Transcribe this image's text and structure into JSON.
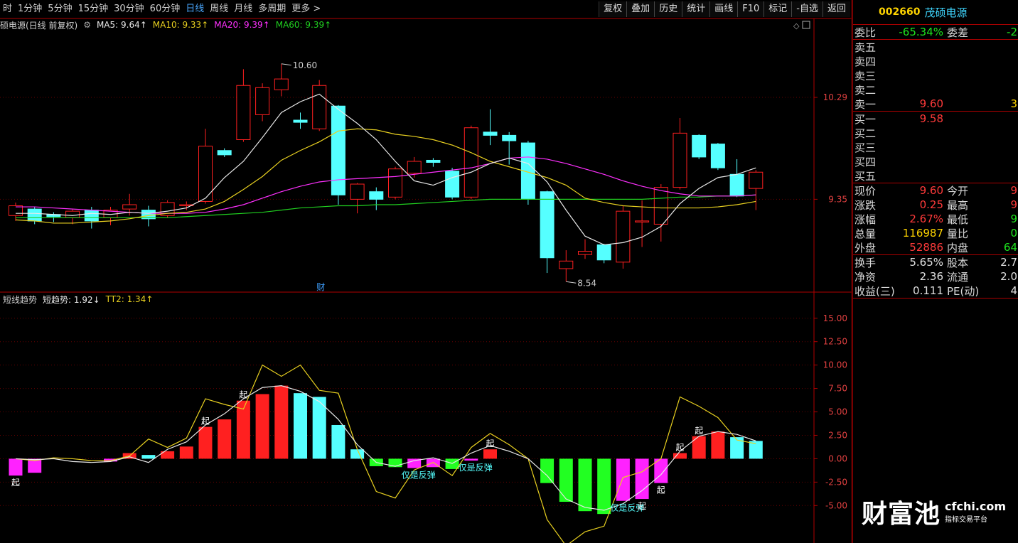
{
  "toolbar": {
    "periods": [
      "时",
      "1分钟",
      "5分钟",
      "15分钟",
      "30分钟",
      "60分钟",
      "日线",
      "周线",
      "月线",
      "多周期",
      "更多 >"
    ],
    "active_index": 6,
    "buttons": [
      "复权",
      "叠加",
      "历史",
      "统计",
      "画线",
      "F10",
      "标记",
      "-自选",
      "返回"
    ]
  },
  "legend": {
    "title": "硕电源(日线 前复权)",
    "ma5": "MA5: 9.64↑",
    "ma10": "MA10: 9.33↑",
    "ma20": "MA20: 9.39↑",
    "ma60": "MA60: 9.39↑"
  },
  "indicator_legend": {
    "name": "短线趋势",
    "short": "短趋势: 1.92↓",
    "tt2": "TT2: 1.34↑"
  },
  "colors": {
    "up": "#ff2020",
    "down": "#55ffff",
    "ma5": "#e8e8e8",
    "ma10": "#e8d020",
    "ma20": "#ff30ff",
    "ma60": "#20d020",
    "tt2": "#e8d020",
    "hist_green": "#22ff22",
    "hist_magenta": "#ff22ff",
    "axis": "#b00000"
  },
  "chart_data": [
    {
      "type": "candlestick",
      "name": "daily-kline",
      "price_axis": {
        "min": 8.5,
        "max": 10.9,
        "ticks": [
          10.29,
          9.35
        ]
      },
      "high_label": "10.60",
      "low_label": "8.54",
      "marker": "财",
      "candles": [
        {
          "o": 9.2,
          "c": 9.29,
          "h": 9.32,
          "l": 9.15
        },
        {
          "o": 9.26,
          "c": 9.15,
          "h": 9.28,
          "l": 9.12
        },
        {
          "o": 9.21,
          "c": 9.19,
          "h": 9.23,
          "l": 9.14
        },
        {
          "o": 9.18,
          "c": 9.24,
          "h": 9.26,
          "l": 9.12
        },
        {
          "o": 9.25,
          "c": 9.15,
          "h": 9.28,
          "l": 9.08
        },
        {
          "o": 9.18,
          "c": 9.25,
          "h": 9.28,
          "l": 9.11
        },
        {
          "o": 9.26,
          "c": 9.3,
          "h": 9.4,
          "l": 9.2
        },
        {
          "o": 9.25,
          "c": 9.17,
          "h": 9.29,
          "l": 9.1
        },
        {
          "o": 9.2,
          "c": 9.32,
          "h": 9.34,
          "l": 9.18
        },
        {
          "o": 9.3,
          "c": 9.3,
          "h": 9.33,
          "l": 9.25
        },
        {
          "o": 9.33,
          "c": 9.84,
          "h": 10.0,
          "l": 9.31
        },
        {
          "o": 9.8,
          "c": 9.76,
          "h": 9.82,
          "l": 9.74
        },
        {
          "o": 9.9,
          "c": 10.4,
          "h": 10.55,
          "l": 9.88
        },
        {
          "o": 10.13,
          "c": 10.38,
          "h": 10.42,
          "l": 10.07
        },
        {
          "o": 10.36,
          "c": 10.46,
          "h": 10.6,
          "l": 10.3
        },
        {
          "o": 10.08,
          "c": 10.06,
          "h": 10.15,
          "l": 10.0
        },
        {
          "o": 10.0,
          "c": 10.4,
          "h": 10.45,
          "l": 9.98
        },
        {
          "o": 10.21,
          "c": 9.39,
          "h": 10.22,
          "l": 9.3
        },
        {
          "o": 9.35,
          "c": 9.49,
          "h": 9.5,
          "l": 9.22
        },
        {
          "o": 9.42,
          "c": 9.35,
          "h": 9.46,
          "l": 9.25
        },
        {
          "o": 9.37,
          "c": 9.63,
          "h": 9.65,
          "l": 9.35
        },
        {
          "o": 9.59,
          "c": 9.7,
          "h": 9.74,
          "l": 9.55
        },
        {
          "o": 9.71,
          "c": 9.69,
          "h": 9.73,
          "l": 9.65
        },
        {
          "o": 9.61,
          "c": 9.37,
          "h": 9.64,
          "l": 9.35
        },
        {
          "o": 9.37,
          "c": 10.01,
          "h": 10.03,
          "l": 9.35
        },
        {
          "o": 9.97,
          "c": 9.94,
          "h": 10.18,
          "l": 9.85
        },
        {
          "o": 9.94,
          "c": 9.89,
          "h": 9.97,
          "l": 9.67
        },
        {
          "o": 9.87,
          "c": 9.35,
          "h": 9.89,
          "l": 9.3
        },
        {
          "o": 9.42,
          "c": 8.81,
          "h": 9.43,
          "l": 8.67
        },
        {
          "o": 8.71,
          "c": 8.78,
          "h": 8.88,
          "l": 8.59
        },
        {
          "o": 8.84,
          "c": 8.87,
          "h": 8.98,
          "l": 8.8
        },
        {
          "o": 8.93,
          "c": 8.79,
          "h": 8.94,
          "l": 8.76
        },
        {
          "o": 8.77,
          "c": 9.24,
          "h": 9.29,
          "l": 8.71
        },
        {
          "o": 9.15,
          "c": 9.15,
          "h": 9.34,
          "l": 8.91
        },
        {
          "o": 9.12,
          "c": 9.46,
          "h": 9.49,
          "l": 8.96
        },
        {
          "o": 9.46,
          "c": 9.96,
          "h": 10.1,
          "l": 9.44
        },
        {
          "o": 9.94,
          "c": 9.74,
          "h": 9.95,
          "l": 9.72
        },
        {
          "o": 9.86,
          "c": 9.64,
          "h": 9.87,
          "l": 9.62
        },
        {
          "o": 9.58,
          "c": 9.38,
          "h": 9.72,
          "l": 9.37
        },
        {
          "o": 9.45,
          "c": 9.6,
          "h": 9.62,
          "l": 9.25
        }
      ],
      "ma5": [
        9.22,
        9.22,
        9.21,
        9.2,
        9.22,
        9.21,
        9.23,
        9.22,
        9.24,
        9.27,
        9.36,
        9.55,
        9.7,
        9.92,
        10.15,
        10.25,
        10.32,
        10.18,
        10.05,
        9.9,
        9.7,
        9.52,
        9.48,
        9.55,
        9.6,
        9.68,
        9.73,
        9.68,
        9.51,
        9.25,
        9.01,
        8.93,
        8.95,
        9.0,
        9.1,
        9.31,
        9.45,
        9.55,
        9.58,
        9.64
      ],
      "ma10": [
        9.16,
        9.15,
        9.13,
        9.13,
        9.14,
        9.15,
        9.17,
        9.2,
        9.22,
        9.23,
        9.26,
        9.33,
        9.44,
        9.56,
        9.71,
        9.8,
        9.88,
        9.98,
        10.0,
        9.99,
        9.95,
        9.93,
        9.9,
        9.85,
        9.78,
        9.7,
        9.65,
        9.6,
        9.55,
        9.48,
        9.36,
        9.32,
        9.29,
        9.28,
        9.27,
        9.27,
        9.27,
        9.28,
        9.3,
        9.33
      ],
      "ma20": [
        9.28,
        9.28,
        9.27,
        9.26,
        9.25,
        9.24,
        9.23,
        9.22,
        9.22,
        9.22,
        9.23,
        9.26,
        9.3,
        9.36,
        9.42,
        9.47,
        9.51,
        9.53,
        9.54,
        9.55,
        9.56,
        9.58,
        9.6,
        9.62,
        9.64,
        9.68,
        9.73,
        9.74,
        9.72,
        9.68,
        9.63,
        9.58,
        9.52,
        9.47,
        9.43,
        9.4,
        9.38,
        9.38,
        9.38,
        9.39
      ],
      "ma60": [
        9.18,
        9.18,
        9.18,
        9.18,
        9.18,
        9.18,
        9.18,
        9.18,
        9.18,
        9.19,
        9.2,
        9.21,
        9.22,
        9.23,
        9.25,
        9.27,
        9.28,
        9.29,
        9.29,
        9.3,
        9.3,
        9.31,
        9.32,
        9.33,
        9.34,
        9.35,
        9.35,
        9.35,
        9.35,
        9.35,
        9.35,
        9.35,
        9.35,
        9.35,
        9.36,
        9.37,
        9.37,
        9.38,
        9.38,
        9.39
      ]
    },
    {
      "type": "bar",
      "name": "short-trend-indicator",
      "y_axis": {
        "min": -9.0,
        "max": 16.5,
        "ticks": [
          15.0,
          12.5,
          10.0,
          7.5,
          5.0,
          2.5,
          0.0,
          -2.5,
          -5.0
        ]
      },
      "bars": [
        -1.8,
        -1.5,
        0,
        0,
        0,
        -0.3,
        0.6,
        0.4,
        0.8,
        1.3,
        3.4,
        4.2,
        6.2,
        6.9,
        7.8,
        7.0,
        6.6,
        3.6,
        1.0,
        -0.8,
        -0.9,
        -1.0,
        -0.9,
        -1.1,
        -0.2,
        1.0,
        0,
        0,
        -2.6,
        -4.6,
        -5.6,
        -5.9,
        -4.5,
        -4.3,
        -2.6,
        0.6,
        2.4,
        2.9,
        2.3,
        1.9
      ],
      "bar_colors": [
        "m",
        "m",
        "",
        "",
        "",
        "m",
        "r",
        "c",
        "r",
        "r",
        "r",
        "r",
        "r",
        "r",
        "r",
        "c",
        "c",
        "c",
        "c",
        "g",
        "g",
        "m",
        "m",
        "g",
        "m",
        "r",
        "",
        "",
        "g",
        "g",
        "g",
        "g",
        "m",
        "m",
        "m",
        "r",
        "r",
        "r",
        "c",
        "c"
      ],
      "tt2": [
        0,
        -0.2,
        0.1,
        0,
        -0.2,
        -0.2,
        0.3,
        2.1,
        1.2,
        2.2,
        6.4,
        5.8,
        5.3,
        10.0,
        8.8,
        10.0,
        7.3,
        7.0,
        1.0,
        -3.5,
        -4.2,
        -1.2,
        -0.4,
        -1.8,
        1.2,
        2.7,
        1.5,
        0,
        -6.5,
        -9.3,
        -7.8,
        -7.2,
        -2.0,
        -1.4,
        0.0,
        6.6,
        5.6,
        4.4,
        2.0,
        1.6
      ],
      "ma_line": [
        0,
        -0.1,
        0,
        -0.3,
        -0.4,
        -0.3,
        0.2,
        -0.4,
        1.0,
        1.8,
        3.6,
        4.8,
        6.4,
        7.6,
        7.8,
        7.2,
        6.1,
        4.2,
        1.5,
        -0.4,
        -0.8,
        -0.2,
        0.1,
        -0.5,
        0.6,
        1.4,
        0.8,
        0,
        -1.8,
        -4.3,
        -5.2,
        -5.5,
        -4.8,
        -3.4,
        -1.7,
        0.8,
        2.4,
        2.9,
        2.6,
        1.9
      ],
      "labels": [
        {
          "i": 0,
          "text": "起",
          "pos": "below"
        },
        {
          "i": 10,
          "text": "起",
          "pos": "above"
        },
        {
          "i": 12,
          "text": "起",
          "pos": "above"
        },
        {
          "i": 21,
          "text": "仅是反弹",
          "pos": "below"
        },
        {
          "i": 24,
          "text": "仅是反弹",
          "pos": "below"
        },
        {
          "i": 25,
          "text": "起",
          "pos": "above"
        },
        {
          "i": 32,
          "text": "仅是反弹",
          "pos": "below"
        },
        {
          "i": 33,
          "text": "起",
          "pos": "below"
        },
        {
          "i": 34,
          "text": "起",
          "pos": "below"
        },
        {
          "i": 35,
          "text": "起",
          "pos": "above"
        },
        {
          "i": 36,
          "text": "起",
          "pos": "above"
        }
      ]
    }
  ],
  "panel": {
    "code": "002660",
    "name": "茂硕电源",
    "weibi": {
      "label": "委比",
      "value": "-65.34%",
      "label2": "委差",
      "value2": "-2"
    },
    "sells": [
      {
        "label": "卖五",
        "price": "",
        "vol": ""
      },
      {
        "label": "卖四",
        "price": "",
        "vol": ""
      },
      {
        "label": "卖三",
        "price": "",
        "vol": ""
      },
      {
        "label": "卖二",
        "price": "",
        "vol": ""
      },
      {
        "label": "卖一",
        "price": "9.60",
        "vol": "3"
      }
    ],
    "buys": [
      {
        "label": "买一",
        "price": "9.58",
        "vol": ""
      },
      {
        "label": "买二",
        "price": "",
        "vol": ""
      },
      {
        "label": "买三",
        "price": "",
        "vol": ""
      },
      {
        "label": "买四",
        "price": "",
        "vol": ""
      },
      {
        "label": "买五",
        "price": "",
        "vol": ""
      }
    ],
    "quotes": [
      {
        "label": "现价",
        "value": "9.60",
        "vc": "red",
        "label2": "今开",
        "value2": "9",
        "vc2": "red"
      },
      {
        "label": "涨跌",
        "value": "0.25",
        "vc": "red",
        "label2": "最高",
        "value2": "9",
        "vc2": "red"
      },
      {
        "label": "涨幅",
        "value": "2.67%",
        "vc": "red",
        "label2": "最低",
        "value2": "9",
        "vc2": "green"
      },
      {
        "label": "总量",
        "value": "116987",
        "vc": "yellow",
        "label2": "量比",
        "value2": "0",
        "vc2": "green"
      },
      {
        "label": "外盘",
        "value": "52886",
        "vc": "red",
        "label2": "内盘",
        "value2": "64",
        "vc2": "green"
      }
    ],
    "stats": [
      {
        "label": "换手",
        "value": "5.65%",
        "label2": "股本",
        "value2": "2.7"
      },
      {
        "label": "净资",
        "value": "2.36",
        "label2": "流通",
        "value2": "2.0"
      },
      {
        "label": "收益(三)",
        "value": "0.111",
        "label2": "PE(动)",
        "value2": "4"
      }
    ]
  },
  "watermark": {
    "main": "财富池",
    "url": "cfchi.com",
    "sub": "指标交易平台"
  }
}
